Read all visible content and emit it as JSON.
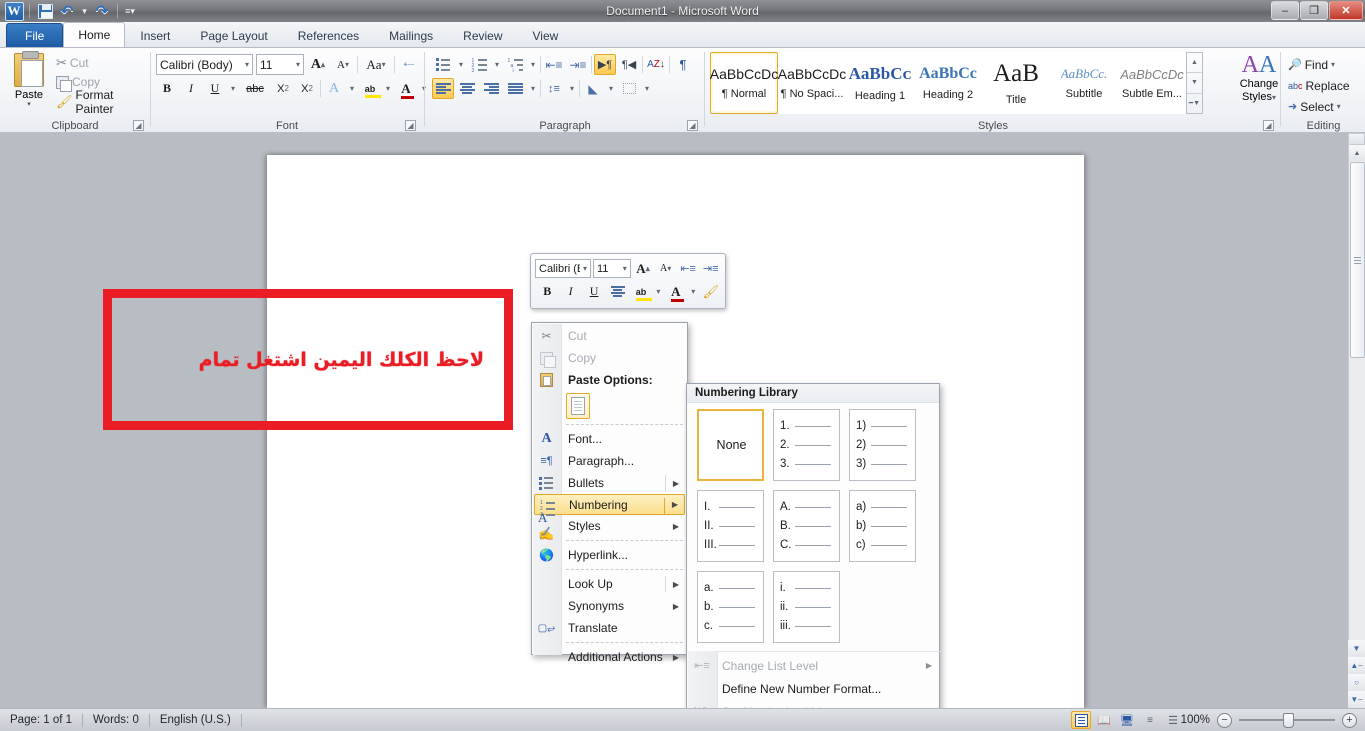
{
  "window": {
    "title": "Document1  -  Microsoft Word",
    "quick_access": [
      {
        "name": "word-logo",
        "label": "W"
      },
      {
        "name": "save",
        "label": "Save"
      },
      {
        "name": "undo",
        "label": "Undo"
      },
      {
        "name": "redo",
        "label": "Redo"
      },
      {
        "name": "customize-qat",
        "label": "Customize Quick Access Toolbar"
      }
    ],
    "controls": {
      "minimize": "–",
      "restore": "❐",
      "close": "✕"
    }
  },
  "tabs": [
    {
      "label": "File",
      "type": "file"
    },
    {
      "label": "Home",
      "type": "active"
    },
    {
      "label": "Insert",
      "type": "normal"
    },
    {
      "label": "Page Layout",
      "type": "normal"
    },
    {
      "label": "References",
      "type": "normal"
    },
    {
      "label": "Mailings",
      "type": "normal"
    },
    {
      "label": "Review",
      "type": "normal"
    },
    {
      "label": "View",
      "type": "normal"
    }
  ],
  "ribbon": {
    "clipboard": {
      "group_label": "Clipboard",
      "paste": "Paste",
      "cut": "Cut",
      "copy": "Copy",
      "format_painter": "Format Painter"
    },
    "font": {
      "group_label": "Font",
      "font_name": "Calibri (Body)",
      "font_size": "11",
      "buttons": {
        "grow_font": "A",
        "shrink_font": "A",
        "change_case": "Aa",
        "clear_formatting": "Aa",
        "bold": "B",
        "italic": "I",
        "underline": "U",
        "strikethrough": "abc",
        "subscript": "X₂",
        "superscript": "X²",
        "text_effects": "A",
        "highlight": "ab",
        "font_color": "A"
      }
    },
    "paragraph": {
      "group_label": "Paragraph",
      "buttons": {
        "bullets": "Bullets",
        "numbering": "Numbering",
        "multilevel_list": "Multilevel List",
        "decrease_indent": "Decrease Indent",
        "increase_indent": "Increase Indent",
        "ltr": "Left-to-Right Text Direction",
        "rtl": "Right-to-Left Text Direction",
        "sort": "Sort",
        "show_marks": "¶",
        "align_left": "Align Left",
        "align_center": "Center",
        "align_right": "Align Right",
        "justify": "Justify",
        "line_spacing": "Line and Paragraph Spacing",
        "shading": "Shading",
        "borders": "Borders"
      }
    },
    "styles": {
      "group_label": "Styles",
      "gallery": [
        {
          "preview": "AaBbCcDc",
          "name": "¶ Normal",
          "selected": true
        },
        {
          "preview": "AaBbCcDc",
          "name": "¶ No Spaci...",
          "selected": false
        },
        {
          "preview": "AaBbCᴄ",
          "name": "Heading 1",
          "selected": false
        },
        {
          "preview": "AaBbCc",
          "name": "Heading 2",
          "selected": false
        },
        {
          "preview": "AаВ",
          "name": "Title",
          "selected": false
        },
        {
          "preview": "AaBbCc.",
          "name": "Subtitle",
          "selected": false
        },
        {
          "preview": "AaBbCcDᴄ",
          "name": "Subtle Em...",
          "selected": false
        }
      ],
      "change_styles": "Change\nStyles"
    },
    "editing": {
      "group_label": "Editing",
      "find": "Find",
      "replace": "Replace",
      "select": "Select"
    }
  },
  "annotation": {
    "text": "لاحظ الكلك اليمين اشتغل تمام",
    "color": "#ea1c24"
  },
  "mini_toolbar": {
    "font_name": "Calibri (B",
    "font_size": "11",
    "grow_font": "A",
    "shrink_font": "A",
    "increase_indent": "Increase Indent",
    "decrease_indent": "Decrease Indent",
    "bold": "B",
    "italic": "I",
    "underline": "U",
    "center": "Center",
    "highlight": "ab",
    "font_color": "A",
    "format_painter": "Format Painter"
  },
  "context_menu": {
    "items": [
      {
        "label": "Cut",
        "icon": "scissors-icon",
        "state": "disabled",
        "submenu": false
      },
      {
        "label": "Copy",
        "icon": "copy-icon",
        "state": "disabled",
        "submenu": false
      },
      {
        "label": "Paste Options:",
        "icon": "paste-icon",
        "state": "header",
        "submenu": false
      },
      {
        "label": "Font...",
        "icon": "font-icon",
        "state": "normal",
        "submenu": false
      },
      {
        "label": "Paragraph...",
        "icon": "paragraph-icon",
        "state": "normal",
        "submenu": false
      },
      {
        "label": "Bullets",
        "icon": "bullets-icon",
        "state": "normal",
        "submenu": true
      },
      {
        "label": "Numbering",
        "icon": "numbering-icon",
        "state": "highlighted",
        "submenu": true
      },
      {
        "label": "Styles",
        "icon": "styles-icon",
        "state": "normal",
        "submenu": true
      },
      {
        "label": "Hyperlink...",
        "icon": "hyperlink-icon",
        "state": "normal",
        "submenu": false
      },
      {
        "label": "Look Up",
        "icon": "none",
        "state": "normal",
        "submenu": true
      },
      {
        "label": "Synonyms",
        "icon": "none",
        "state": "normal",
        "submenu": true
      },
      {
        "label": "Translate",
        "icon": "translate-icon",
        "state": "normal",
        "submenu": false
      },
      {
        "label": "Additional Actions",
        "icon": "none",
        "state": "normal",
        "submenu": true
      }
    ]
  },
  "numbering_library": {
    "header": "Numbering Library",
    "cells": [
      {
        "type": "none",
        "label": "None",
        "selected": true
      },
      {
        "type": "list",
        "items": [
          "1.",
          "2.",
          "3."
        ],
        "selected": false
      },
      {
        "type": "list",
        "items": [
          "1)",
          "2)",
          "3)"
        ],
        "selected": false
      },
      {
        "type": "list",
        "items": [
          "I.",
          "II.",
          "III."
        ],
        "selected": false
      },
      {
        "type": "list",
        "items": [
          "A.",
          "B.",
          "C."
        ],
        "selected": false
      },
      {
        "type": "list",
        "items": [
          "a)",
          "b)",
          "c)"
        ],
        "selected": false
      },
      {
        "type": "list",
        "items": [
          "a.",
          "b.",
          "c."
        ],
        "selected": false
      },
      {
        "type": "list",
        "items": [
          "i.",
          "ii.",
          "iii."
        ],
        "selected": false
      }
    ],
    "footer": [
      {
        "label": "Change List Level",
        "state": "disabled",
        "submenu": true,
        "icon": "list-level-icon"
      },
      {
        "label": "Define New Number Format...",
        "state": "normal",
        "submenu": false,
        "icon": "none"
      },
      {
        "label": "Set Numbering Value...",
        "state": "disabled",
        "submenu": false,
        "icon": "set-value-icon"
      }
    ]
  },
  "status_bar": {
    "page": "Page: 1 of 1",
    "words": "Words: 0",
    "language": "English (U.S.)",
    "views": [
      {
        "name": "print-layout",
        "active": true
      },
      {
        "name": "full-screen-reading",
        "active": false
      },
      {
        "name": "web-layout",
        "active": false
      },
      {
        "name": "outline",
        "active": false
      },
      {
        "name": "draft",
        "active": false
      }
    ],
    "zoom": "100%",
    "zoom_out": "−",
    "zoom_in": "+"
  }
}
